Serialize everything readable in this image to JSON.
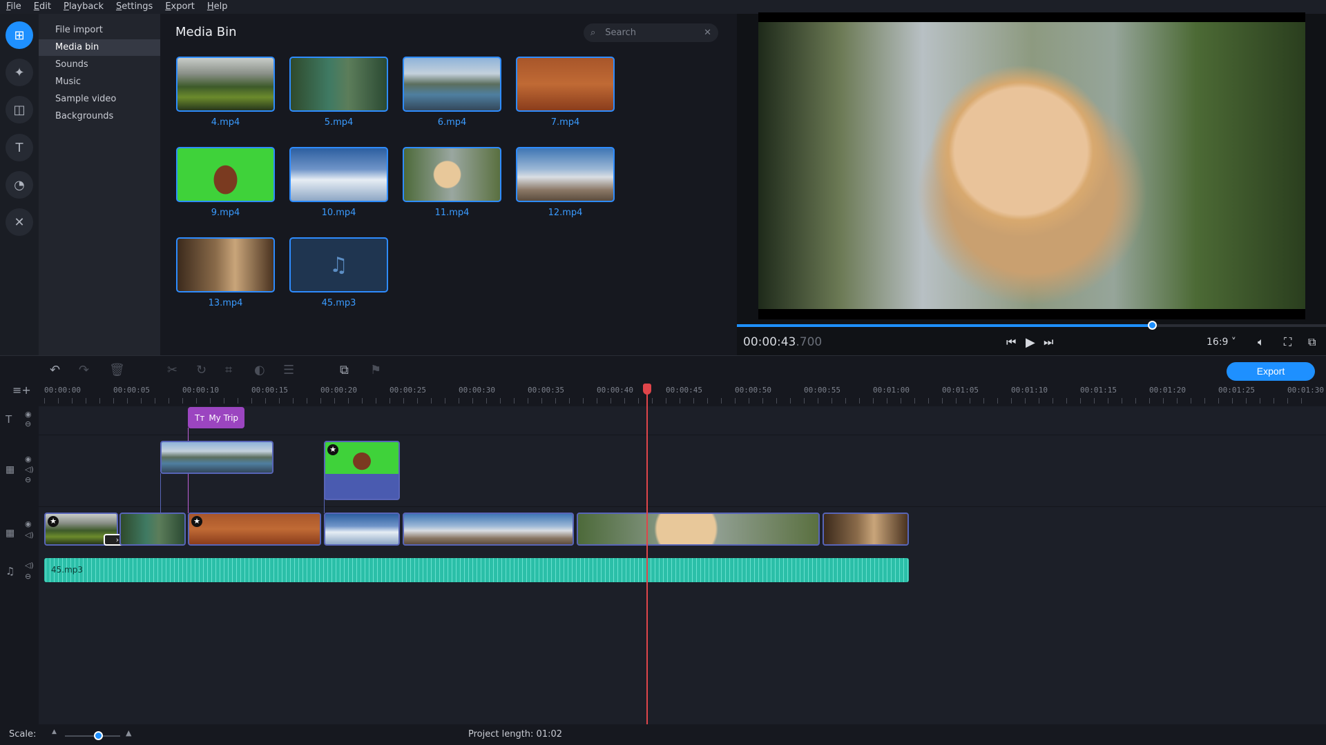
{
  "menu": [
    "File",
    "Edit",
    "Playback",
    "Settings",
    "Export",
    "Help"
  ],
  "rail": [
    "import-icon",
    "magic-wand-icon",
    "transitions-icon",
    "titles-icon",
    "stickers-icon",
    "tools-icon"
  ],
  "categories": [
    "File import",
    "Media bin",
    "Sounds",
    "Music",
    "Sample video",
    "Backgrounds"
  ],
  "selected_category": "Media bin",
  "bin": {
    "title": "Media Bin",
    "search_placeholder": "Search",
    "items": [
      "4.mp4",
      "5.mp4",
      "6.mp4",
      "7.mp4",
      "9.mp4",
      "10.mp4",
      "11.mp4",
      "12.mp4",
      "13.mp4",
      "45.mp3"
    ]
  },
  "player": {
    "timecode": "00:00:43",
    "timecode_ms": ".700",
    "progress_percent": 70.5,
    "aspect": "16:9 ˅"
  },
  "timeline": {
    "export_label": "Export",
    "ruler": [
      "00:00:00",
      "00:00:05",
      "00:00:10",
      "00:00:15",
      "00:00:20",
      "00:00:25",
      "00:00:30",
      "00:00:35",
      "00:00:40",
      "00:00:45",
      "00:00:50",
      "00:00:55",
      "00:01:00",
      "00:01:05",
      "00:01:10",
      "00:01:15",
      "00:01:20",
      "00:01:25",
      "00:01:30"
    ],
    "playhead": "00:00:43.700",
    "title_clip": "My Trip",
    "audio_clip": "45.mp3"
  },
  "status": {
    "scale_label": "Scale:",
    "scale_level": 0.6,
    "project_length": "Project length:  01:02"
  },
  "colors": {
    "accent": "#1e90ff",
    "title_clip": "#9b45c0",
    "audio_clip": "#2bbfa8",
    "playhead": "#e0454a"
  }
}
